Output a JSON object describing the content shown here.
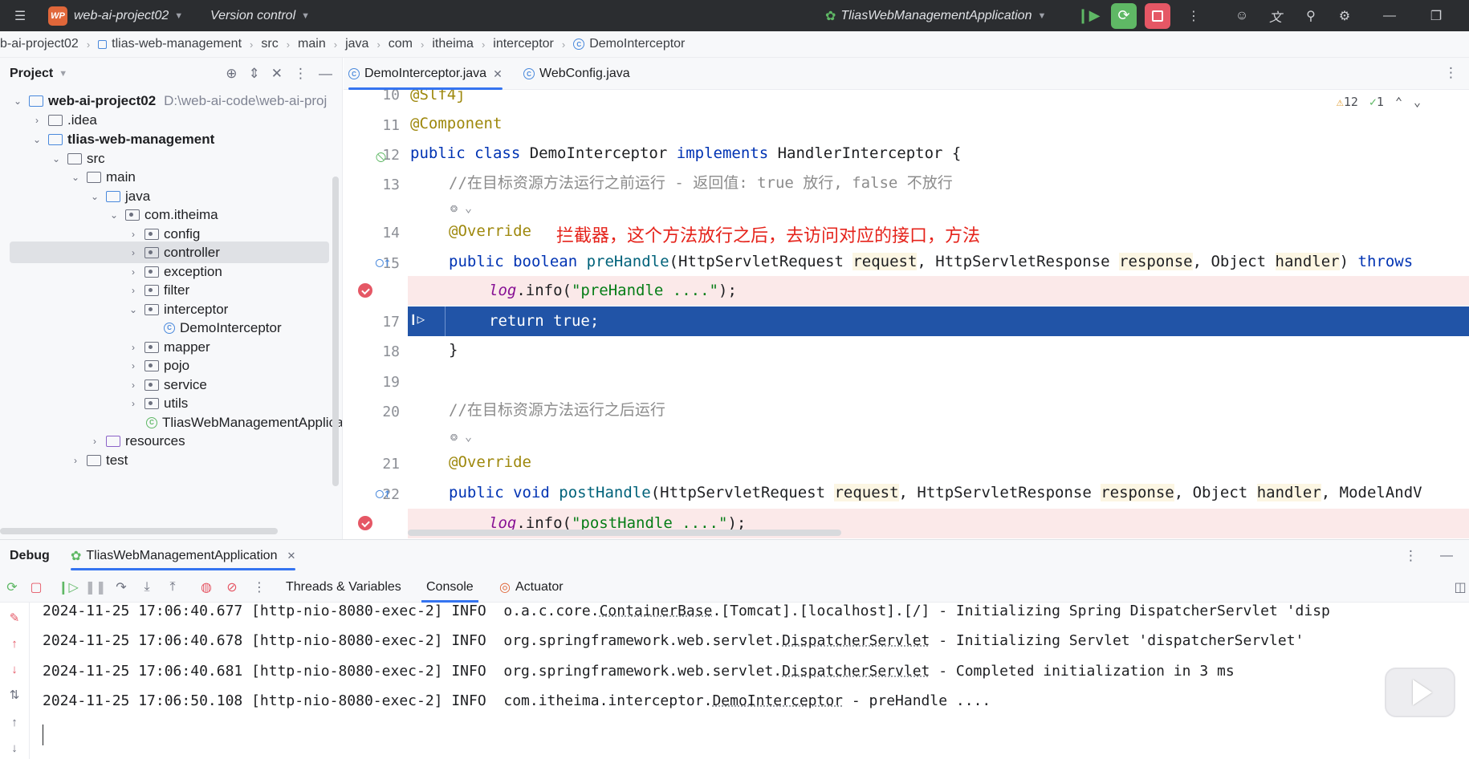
{
  "titlebar": {
    "project_badge": "WP",
    "project_name": "web-ai-project02",
    "vcs": "Version control",
    "run_config": "TliasWebManagementApplication"
  },
  "breadcrumb": [
    "b-ai-project02",
    "tlias-web-management",
    "src",
    "main",
    "java",
    "com",
    "itheima",
    "interceptor",
    "DemoInterceptor"
  ],
  "project": {
    "title": "Project",
    "tree": [
      {
        "label": "web-ai-project02",
        "path": "D:\\web-ai-code\\web-ai-proj",
        "bold": true
      },
      {
        "label": ".idea"
      },
      {
        "label": "tlias-web-management",
        "bold": true
      },
      {
        "label": "src"
      },
      {
        "label": "main"
      },
      {
        "label": "java"
      },
      {
        "label": "com.itheima"
      },
      {
        "label": "config"
      },
      {
        "label": "controller"
      },
      {
        "label": "exception"
      },
      {
        "label": "filter"
      },
      {
        "label": "interceptor"
      },
      {
        "label": "DemoInterceptor"
      },
      {
        "label": "mapper"
      },
      {
        "label": "pojo"
      },
      {
        "label": "service"
      },
      {
        "label": "utils"
      },
      {
        "label": "TliasWebManagementApplica"
      },
      {
        "label": "resources"
      },
      {
        "label": "test"
      }
    ]
  },
  "editor": {
    "tabs": [
      "DemoInterceptor.java",
      "WebConfig.java"
    ],
    "inspections": {
      "warnings": "12",
      "ok": "1"
    },
    "line_numbers": [
      "10",
      "11",
      "12",
      "13",
      "14",
      "15",
      "17",
      "18",
      "19",
      "20",
      "21",
      "22"
    ],
    "overlay_note": "拦截器，这个方法放行之后，去访问对应的接口，方法",
    "code": {
      "l10": "@Slf4j",
      "l11": "@Component",
      "l12_kw1": "public class",
      "l12_name": " DemoInterceptor ",
      "l12_kw2": "implements",
      "l12_rest": " HandlerInterceptor {",
      "l13": "//在目标资源方法运行之前运行 - 返回值: true 放行, false 不放行",
      "l14": "@Override",
      "l15_kw": "public boolean",
      "l15_fn": " preHandle",
      "l15_a": "(HttpServletRequest ",
      "l15_p1": "request",
      "l15_b": ", HttpServletResponse ",
      "l15_p2": "response",
      "l15_c": ", Object ",
      "l15_p3": "handler",
      "l15_d": ") ",
      "l15_kw2": "throws",
      "l16_log": "log",
      "l16_call": ".info(",
      "l16_str": "\"preHandle ....\"",
      "l16_end": ");",
      "l17": "return true;",
      "l18": "}",
      "l20": "//在目标资源方法运行之后运行",
      "l21": "@Override",
      "l22_kw": "public void",
      "l22_fn": " postHandle",
      "l22_a": "(HttpServletRequest ",
      "l22_p1": "request",
      "l22_b": ", HttpServletResponse ",
      "l22_p2": "response",
      "l22_c": ", Object ",
      "l22_p3": "handler",
      "l22_d": ", ModelAndV",
      "l23_log": "log",
      "l23_call": ".info(",
      "l23_str": "\"postHandle ....\"",
      "l23_end": ");"
    }
  },
  "debug": {
    "title": "Debug",
    "session": "TliasWebManagementApplication",
    "tabs": [
      "Threads & Variables",
      "Console",
      "Actuator"
    ],
    "console": [
      {
        "pre": "2024-11-25 17:06:40.677 [http-nio-8080-exec-2] INFO  o.a.c.core.",
        "ul": "ContainerBase",
        "post": ".[Tomcat].[localhost].[/] - Initializing Spring DispatcherServlet 'disp"
      },
      {
        "pre": "2024-11-25 17:06:40.678 [http-nio-8080-exec-2] INFO  org.springframework.web.servlet.",
        "ul": "DispatcherServlet",
        "post": " - Initializing Servlet 'dispatcherServlet'"
      },
      {
        "pre": "2024-11-25 17:06:40.681 [http-nio-8080-exec-2] INFO  org.springframework.web.servlet.",
        "ul": "DispatcherServlet",
        "post": " - Completed initialization in 3 ms"
      },
      {
        "pre": "2024-11-25 17:06:50.108 [http-nio-8080-exec-2] INFO  com.itheima.interceptor.",
        "ul": "DemoInterceptor",
        "post": " - preHandle ...."
      }
    ]
  },
  "colors": {
    "accent": "#3574f0",
    "execution_line": "#2154a7",
    "breakpoint": "#e55765",
    "note": "#e5231b"
  }
}
